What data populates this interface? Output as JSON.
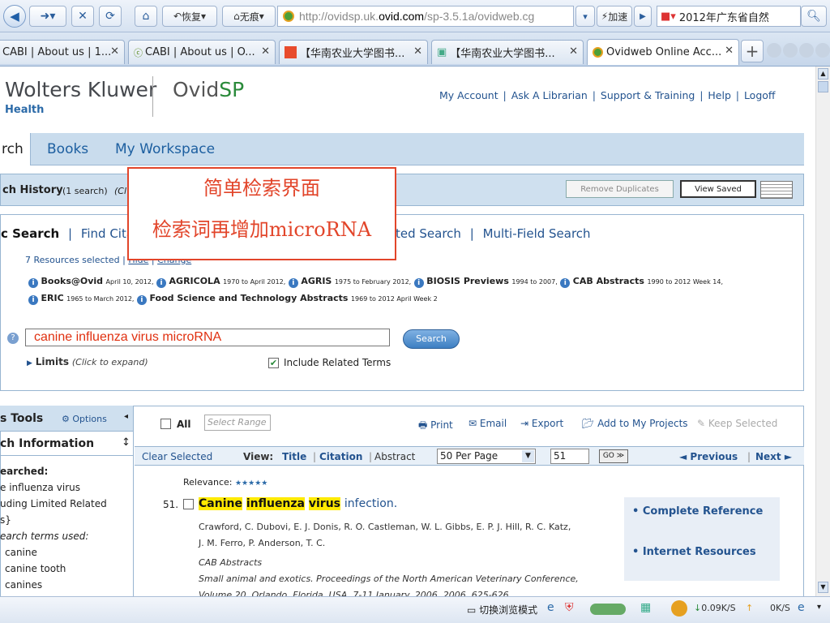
{
  "browser": {
    "restore_label": "恢复",
    "noscript_label": "无痕",
    "url_prefix": "http://ovidsp.uk.",
    "url_domain": "ovid.com",
    "url_suffix": "/sp-3.5.1a/ovidweb.cg",
    "speed_label": "加速",
    "search_text": "2012年广东省自然",
    "tabs": [
      {
        "label": "CABI | About us | 1..."
      },
      {
        "label": "CABI | About us | O..."
      },
      {
        "label": "【华南农业大学图书..."
      },
      {
        "label": "【华南农业大学图书..."
      },
      {
        "label": "Ovidweb Online Acc..."
      }
    ]
  },
  "header": {
    "brand_main": "Wolters Kluwer",
    "brand_sub": "Health",
    "product_a": "Ovid",
    "product_b": "SP",
    "links": [
      "My Account",
      "Ask A Librarian",
      "Support & Training",
      "Help",
      "Logoff"
    ]
  },
  "nav": {
    "items": [
      "rch",
      "Books",
      "My Workspace"
    ]
  },
  "history": {
    "title": "ch History",
    "count": "(1 search)",
    "trunc": "(Cl",
    "remove_duplicates": "Remove Duplicates",
    "view_saved": "View Saved"
  },
  "search": {
    "tabs": [
      "c Search",
      "Find Citat",
      "ted Search",
      "Multi-Field Search"
    ],
    "resources_selected": "7 Resources selected",
    "hide": "Hide",
    "change": "Change",
    "db_line1": [
      {
        "name": "Books@Ovid",
        "range": "April 10, 2012,"
      },
      {
        "name": "AGRICOLA",
        "range": "1970 to April 2012,"
      },
      {
        "name": "AGRIS",
        "range": "1975 to February 2012,"
      },
      {
        "name": "BIOSIS Previews",
        "range": "1994 to 2007,"
      },
      {
        "name": "CAB Abstracts",
        "range": "1990 to 2012 Week 14,"
      }
    ],
    "db_line2": [
      {
        "name": "ERIC",
        "range": "1965 to March 2012,"
      },
      {
        "name": "Food Science and Technology Abstracts",
        "range": "1969 to 2012 April Week 2"
      }
    ],
    "query": "canine influenza virus microRNA",
    "search_button": "Search",
    "limits": "Limits",
    "limits_hint": "(Click to expand)",
    "related_terms": "Include Related Terms"
  },
  "overlay": {
    "line1": "简单检索界面",
    "line2": "检索词再增加microRNA"
  },
  "left_panel": {
    "tools": "s Tools",
    "options": "Options",
    "info": "ch Information",
    "searched": "earched:",
    "searched_lines": [
      "e influenza virus",
      "uding Limited Related",
      "s}"
    ],
    "terms_used": "earch terms used:",
    "terms": [
      "canine",
      "canine tooth",
      "canines"
    ]
  },
  "results_toolbar": {
    "all": "All",
    "select_range": "Select Range",
    "print": "Print",
    "email": "Email",
    "export": "Export",
    "add_projects": "Add to My Projects",
    "keep_selected": "Keep Selected",
    "clear_selected": "Clear Selected",
    "view": "View:",
    "title": "Title",
    "citation": "Citation",
    "abstract": "Abstract",
    "per_page": "50 Per Page",
    "page_num": "51",
    "go": "GO",
    "previous": "◄ Previous",
    "next": "Next ►"
  },
  "result": {
    "relevance": "Relevance:",
    "stars": "★★★★★",
    "number": "51.",
    "title_words": [
      "Canine",
      "influenza",
      "virus"
    ],
    "title_rest": "infection.",
    "authors_1": "Crawford, C. Dubovi, E. J. Donis, R. O. Castleman, W. L. Gibbs, E. P. J. Hill, R. C. Katz,",
    "authors_2": "J. M. Ferro, P. Anderson, T. C.",
    "source": "CAB Abstracts",
    "journal_1": "Small animal and exotics. Proceedings of the North American Veterinary Conference,",
    "journal_2": "Volume 20, Orlando, Florida, USA, 7-11 January, 2006. 2006. 625-626.",
    "links": [
      "Complete Reference",
      "Internet Resources"
    ]
  },
  "statusbar": {
    "mode": "切换浏览模式",
    "down": "0.09K/S",
    "up": "0K/S"
  }
}
